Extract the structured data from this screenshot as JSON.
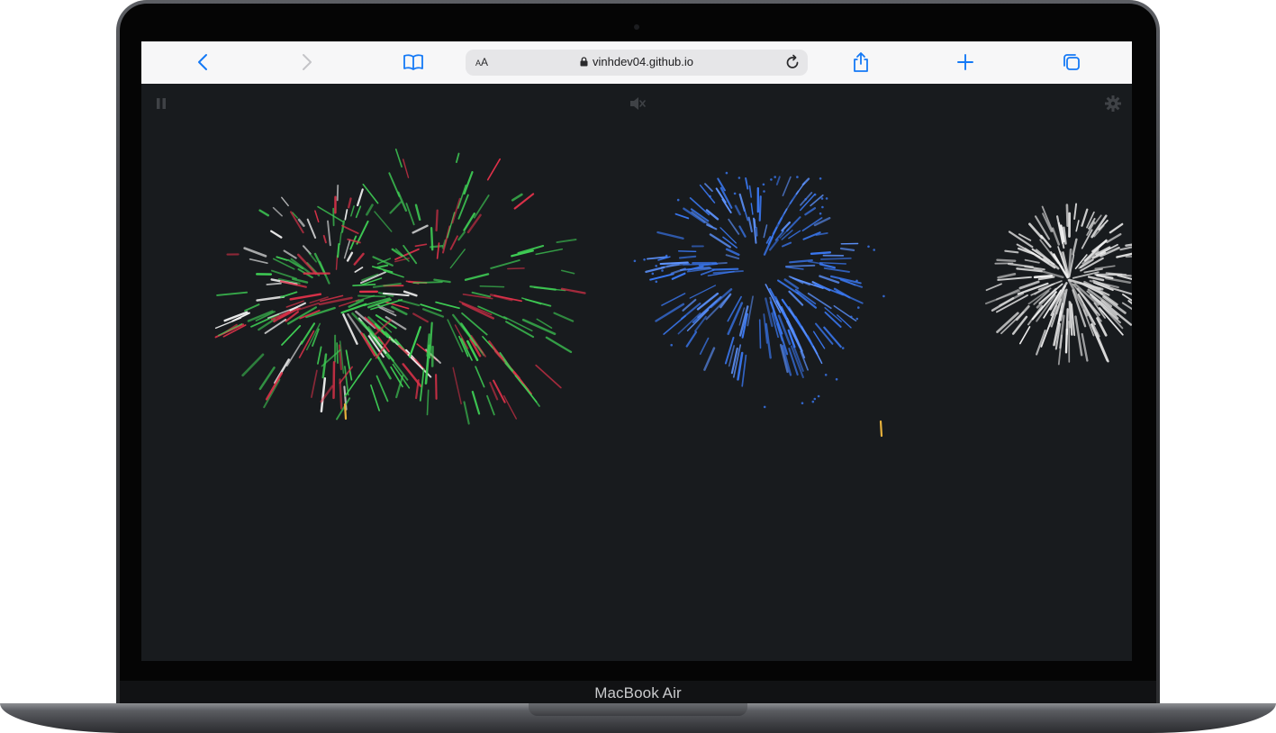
{
  "device": {
    "model_label": "MacBook Air"
  },
  "browser": {
    "aa_label_small": "A",
    "aa_label_large": "A",
    "url": "vinhdev04.github.io",
    "icons": [
      "back-icon",
      "forward-icon",
      "bookmarks-icon",
      "lock-icon",
      "reload-icon",
      "share-icon",
      "new-tab-icon",
      "tabs-icon"
    ]
  },
  "page": {
    "controls": [
      "pause-icon",
      "sound-muted-icon",
      "settings-icon"
    ],
    "fireworks_colors": {
      "red": "#e0324a",
      "green": "#3fcf55",
      "blue": "#3a78f2",
      "white": "#f2f2f2",
      "gold": "#e6b13c"
    }
  }
}
